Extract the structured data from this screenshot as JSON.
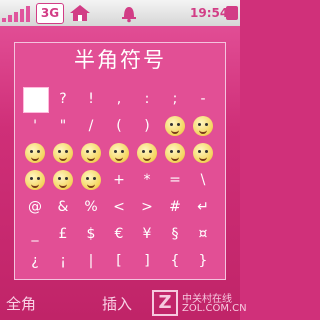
{
  "status": {
    "network_label": "3G",
    "time": "19:54",
    "icons": [
      "signal-icon",
      "3g-icon",
      "home-icon",
      "bell-icon",
      "battery-icon"
    ],
    "accent": "#d23d86"
  },
  "panel": {
    "title": "半角符号",
    "rows": [
      [
        "[sel]",
        "?",
        "!",
        ",",
        ":",
        ";",
        "-"
      ],
      [
        "'",
        "\"",
        "/",
        "(",
        ")",
        "☺",
        "☺"
      ],
      [
        "☺",
        "☺",
        "☺",
        "☺",
        "☺",
        "☺",
        "☺"
      ],
      [
        "☺",
        "☺",
        "☺",
        "+",
        "*",
        "=",
        "\\"
      ],
      [
        "@",
        "&",
        "%",
        "<",
        ">",
        "#",
        "↵"
      ],
      [
        "_",
        "£",
        "$",
        "€",
        "¥",
        "§",
        "¤"
      ],
      [
        "¿",
        "¡",
        "|",
        "[",
        "]",
        "{",
        "}"
      ]
    ]
  },
  "softkeys": {
    "left": "全角",
    "center": "插入"
  },
  "watermark": {
    "letter": "Z",
    "line1": "中关村在线",
    "line2": "ZOL.COM.CN"
  },
  "colors": {
    "background": "#d0307a",
    "panel": "#e24f95"
  }
}
